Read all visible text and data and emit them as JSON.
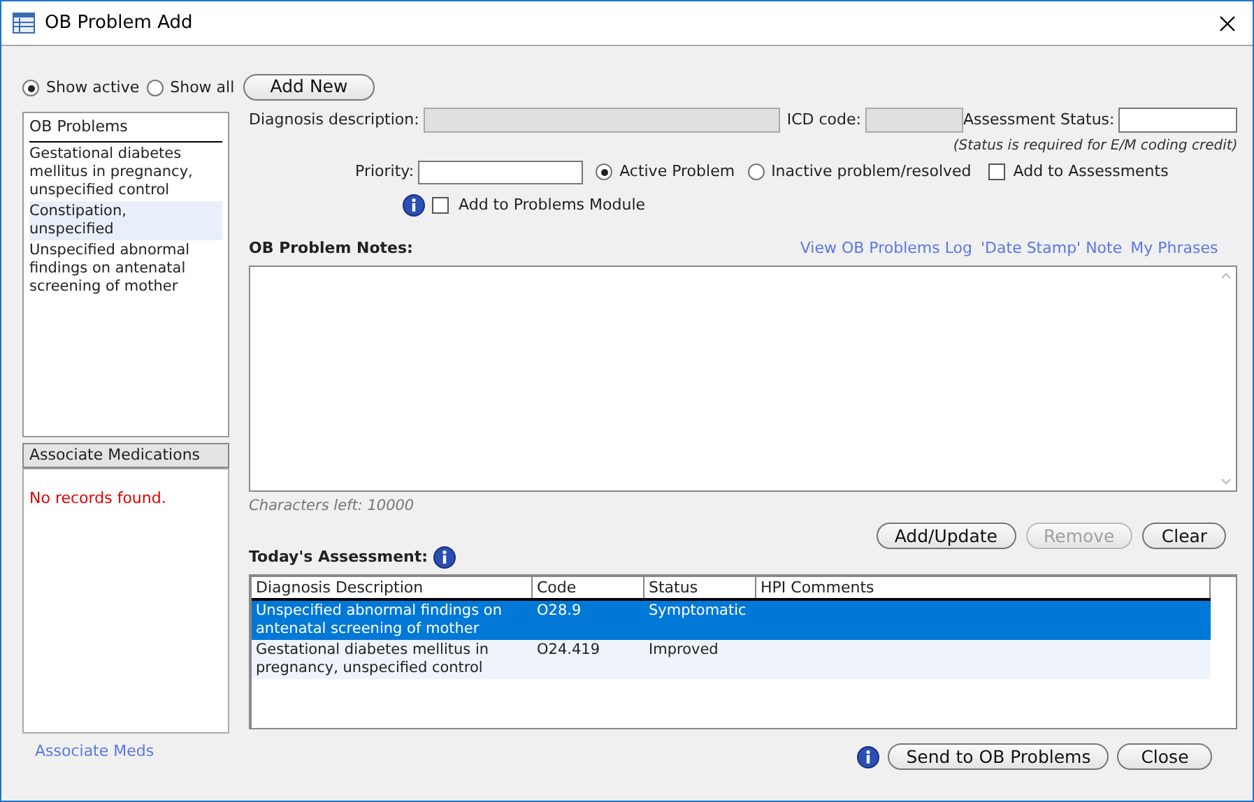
{
  "window": {
    "title": "OB Problem Add"
  },
  "filter": [
    {
      "label": "Show active",
      "selected": true
    },
    {
      "label": "Show all",
      "selected": false
    }
  ],
  "add_new": "Add New",
  "ob_problems": {
    "header": "OB Problems",
    "items": [
      {
        "label": "Gestational diabetes mellitus in pregnancy, unspecified control",
        "selected": false
      },
      {
        "label": "Constipation, unspecified",
        "selected": true
      },
      {
        "label": "Unspecified abnormal findings on antenatal screening of mother",
        "selected": false
      }
    ]
  },
  "medications": {
    "header": "Associate Medications",
    "empty": "No records found."
  },
  "associate_meds_link": "Associate Meds",
  "form": {
    "diagnosis_label": "Diagnosis description:",
    "icd_label": "ICD code:",
    "assessment_status_label": "Assessment Status:",
    "status_hint": "(Status is required for E/M coding credit)",
    "priority_label": "Priority:",
    "problem_state": [
      {
        "label": "Active Problem",
        "selected": true
      },
      {
        "label": "Inactive problem/resolved",
        "selected": false
      }
    ],
    "add_to_assessments": {
      "label": "Add to Assessments",
      "checked": false
    },
    "add_to_problems_module": {
      "label": "Add to Problems Module",
      "checked": false
    }
  },
  "notes": {
    "label": "OB Problem Notes:",
    "links": [
      "View OB Problems Log",
      "'Date Stamp' Note",
      "My Phrases"
    ],
    "chars_left": "Characters left: 10000"
  },
  "note_buttons": [
    {
      "label": "Add/Update",
      "disabled": false
    },
    {
      "label": "Remove",
      "disabled": true
    },
    {
      "label": "Clear",
      "disabled": false
    }
  ],
  "assessment": {
    "title": "Today's Assessment:",
    "columns": [
      "Diagnosis Description",
      "Code",
      "Status",
      "HPI Comments"
    ],
    "rows": [
      {
        "cells": [
          "Unspecified abnormal findings on antenatal screening of mother",
          "O28.9",
          "Symptomatic",
          ""
        ],
        "selected": true
      },
      {
        "cells": [
          "Gestational diabetes mellitus in pregnancy, unspecified control",
          "O24.419",
          "Improved",
          ""
        ],
        "selected": false
      }
    ]
  },
  "footer_buttons": [
    "Send to OB Problems",
    "Close"
  ]
}
